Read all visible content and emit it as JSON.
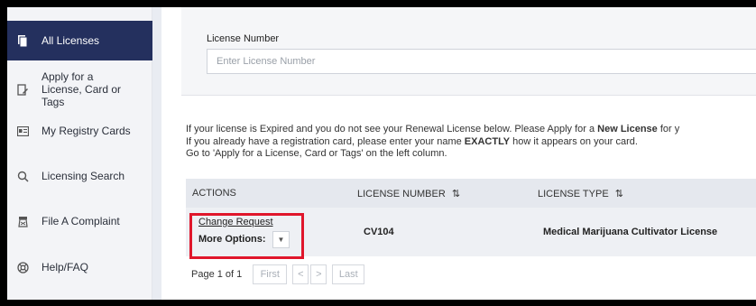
{
  "sidebar": {
    "items": [
      {
        "label": "All Licenses",
        "icon": "document-icon"
      },
      {
        "label": "Apply for a License, Card or Tags",
        "icon": "apply-edit-icon"
      },
      {
        "label": "My Registry Cards",
        "icon": "id-card-icon"
      },
      {
        "label": "Licensing Search",
        "icon": "search-icon"
      },
      {
        "label": "File A Complaint",
        "icon": "complaint-icon"
      },
      {
        "label": "Help/FAQ",
        "icon": "help-lifebuoy-icon"
      }
    ],
    "labels": {
      "all": "All Licenses",
      "apply_1": "Apply for a",
      "apply_2": "License, Card or",
      "apply_3": "Tags",
      "cards": "My Registry Cards",
      "search": "Licensing Search",
      "complaint": "File A Complaint",
      "help": "Help/FAQ"
    }
  },
  "search": {
    "label": "License Number",
    "placeholder": "Enter License Number",
    "value": ""
  },
  "info": {
    "line1_a": "If your license is Expired and you do not see your Renewal License below. Please Apply for a ",
    "line1_b": "New License",
    "line1_c": " for y",
    "line2_a": "If you already have a registration card, please enter your name ",
    "line2_b": "EXACTLY",
    "line2_c": " how it appears on your card.",
    "line3": "Go to 'Apply for a License, Card or Tags' on the left column."
  },
  "table": {
    "headers": {
      "actions": "ACTIONS",
      "license_number": "LICENSE NUMBER",
      "license_type": "LICENSE TYPE"
    },
    "sort_glyph": "⇅",
    "rows": [
      {
        "change_request": "Change Request",
        "more_options": "More Options:",
        "license_number": "CV104",
        "license_type": "Medical Marijuana Cultivator License"
      }
    ]
  },
  "pager": {
    "page_info": "Page 1 of 1",
    "first": "First",
    "prev": "<",
    "next": ">",
    "last": "Last"
  },
  "colors": {
    "sidebar_active": "#24305e",
    "highlight_border": "#e0162b"
  }
}
